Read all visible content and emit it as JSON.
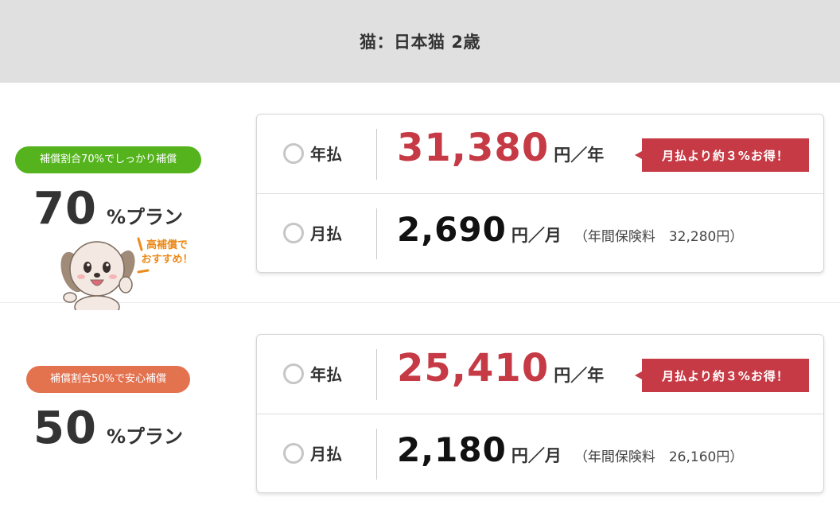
{
  "header": {
    "title": "猫：日本猫 2歳"
  },
  "plans": [
    {
      "badge": "補償割合70%でしっかり補償",
      "percent": "70",
      "suffix": "%プラン",
      "mascot_text_1": "高補償で",
      "mascot_text_2": "おすすめ！",
      "annual": {
        "pay_type": "年払",
        "amount": "31,380",
        "unit": "円／年",
        "deal": "月払より約３%お得！"
      },
      "monthly": {
        "pay_type": "月払",
        "amount": "2,690",
        "unit": "円／月",
        "note": "（年間保険料　32,280円）"
      }
    },
    {
      "badge": "補償割合50%で安心補償",
      "percent": "50",
      "suffix": "%プラン",
      "annual": {
        "pay_type": "年払",
        "amount": "25,410",
        "unit": "円／年",
        "deal": "月払より約３%お得！"
      },
      "monthly": {
        "pay_type": "月払",
        "amount": "2,180",
        "unit": "円／月",
        "note": "（年間保険料　26,160円）"
      }
    }
  ],
  "colors": {
    "accent_red": "#c63a45",
    "badge_green": "#55b41e",
    "badge_orange": "#e3724f",
    "header_bg": "#e0e0e0"
  }
}
